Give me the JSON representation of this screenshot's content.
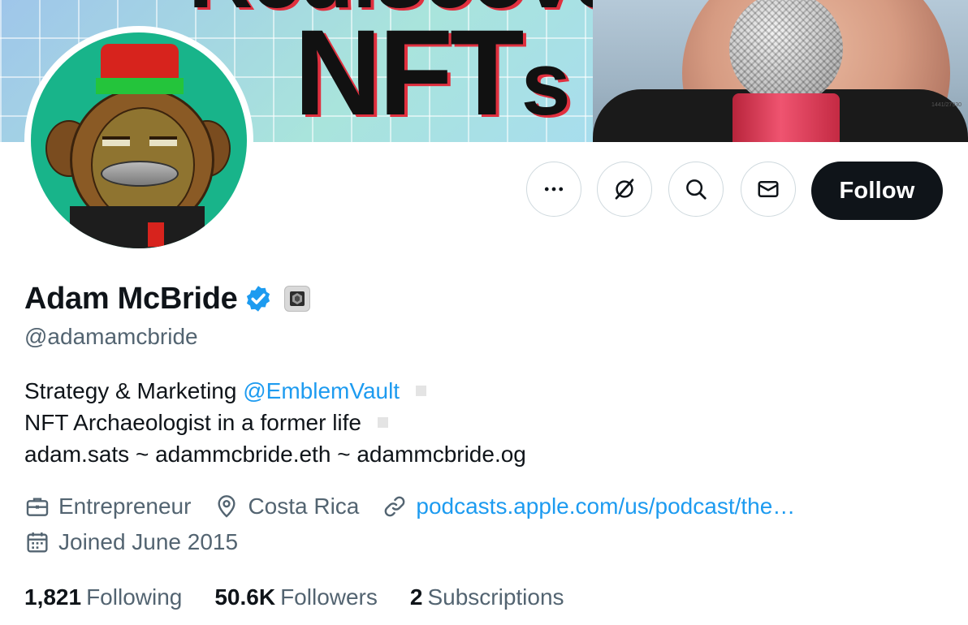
{
  "banner": {
    "title_main": "NFT",
    "title_suffix": "s",
    "top_text": "Rediscover",
    "tag": "1441/27930"
  },
  "profile": {
    "name": "Adam McBride",
    "handle": "@adamamcbride",
    "verified": true
  },
  "actions": {
    "more_icon": "more-icon",
    "grok_icon": "grok-icon",
    "search_icon": "search-icon",
    "message_icon": "mail-icon",
    "follow_label": "Follow"
  },
  "bio": {
    "line1_prefix": "Strategy & Marketing ",
    "line1_mention": "@EmblemVault",
    "line2": "NFT Archaeologist in a former life",
    "line3": "adam.sats ~ adammcbride.eth ~ adammcbride.og"
  },
  "meta": {
    "profession": "Entrepreneur",
    "location": "Costa Rica",
    "website": "podcasts.apple.com/us/podcast/the…",
    "joined": "Joined June 2015"
  },
  "stats": {
    "following_count": "1,821",
    "following_label": "Following",
    "followers_count": "50.6K",
    "followers_label": "Followers",
    "subscriptions_count": "2",
    "subscriptions_label": "Subscriptions"
  },
  "colors": {
    "accent": "#1d9bf0",
    "text_primary": "#0f1419",
    "text_secondary": "#536471",
    "follow_bg": "#0f1419"
  }
}
